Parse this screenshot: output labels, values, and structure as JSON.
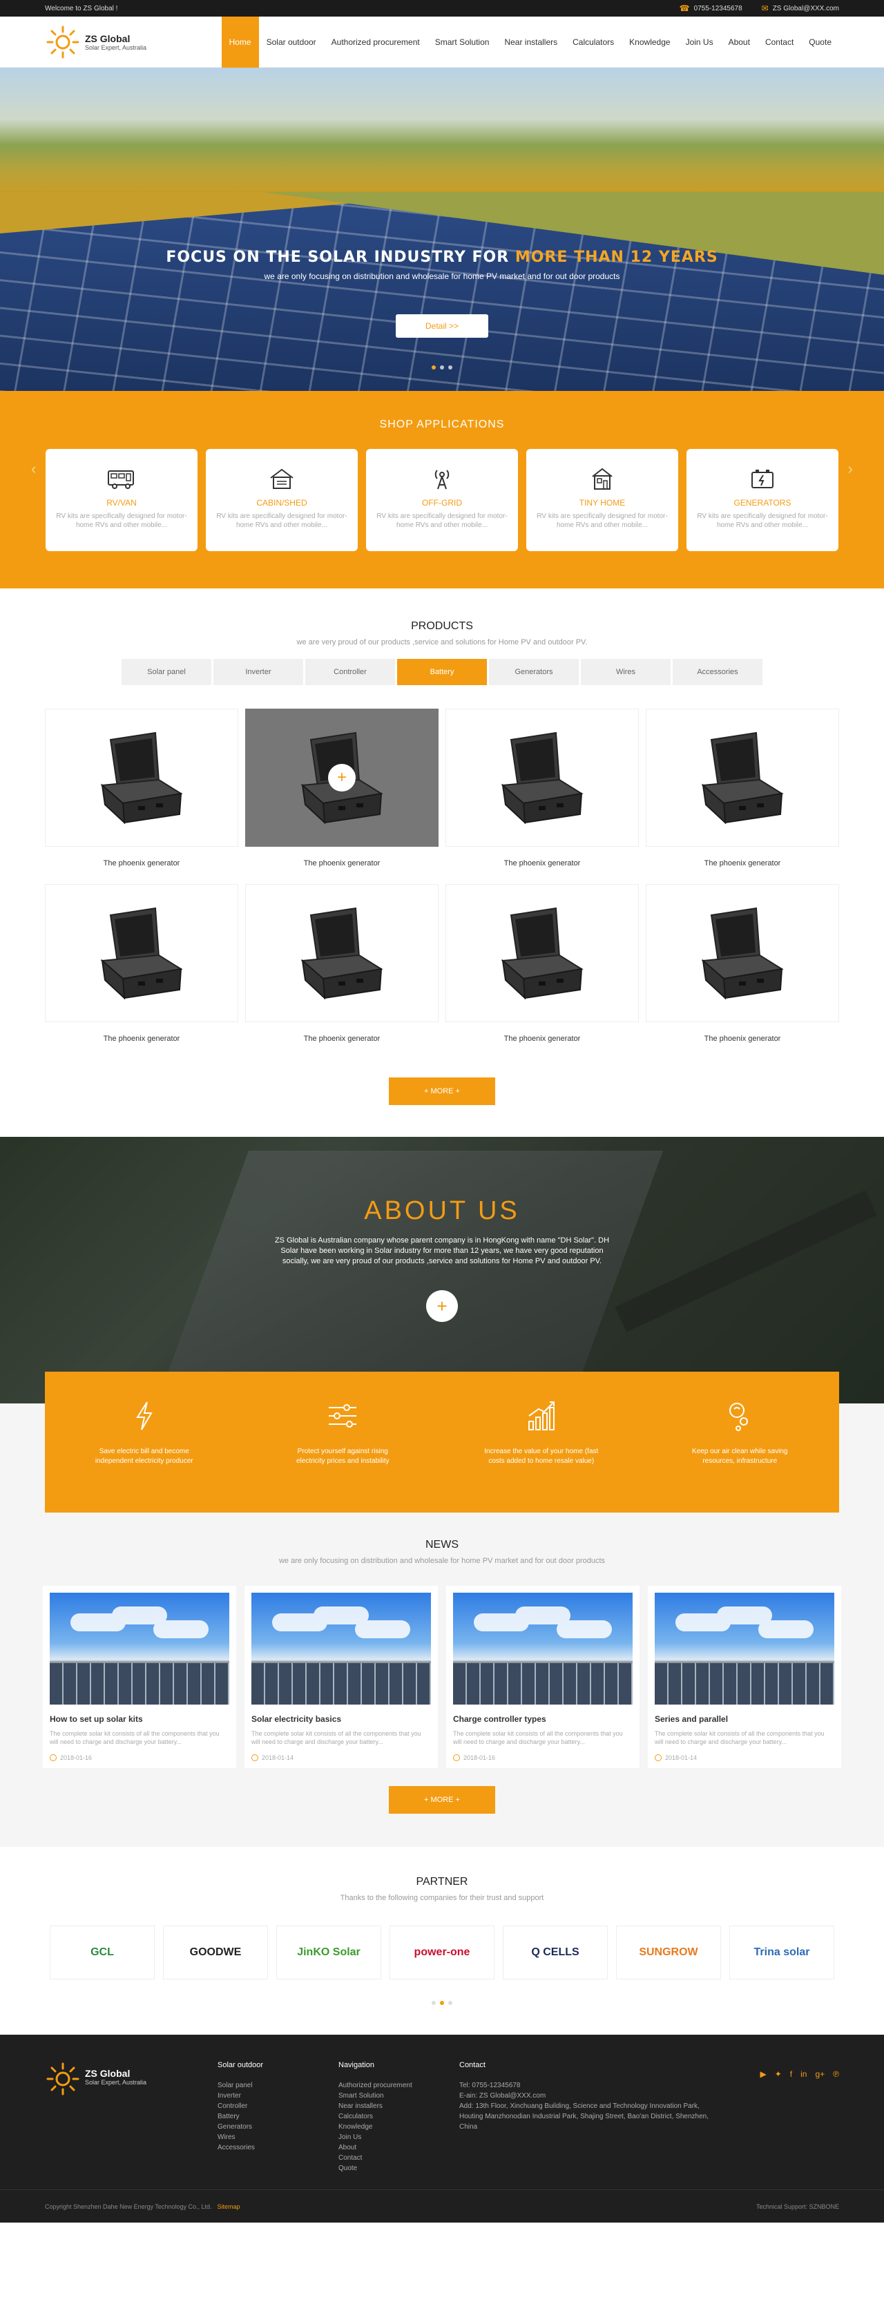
{
  "topbar": {
    "welcome": "Welcome to ZS Global !",
    "phone": "0755-12345678",
    "email": "ZS Global@XXX.com"
  },
  "brand": {
    "name": "ZS Global",
    "tagline": "Solar Expert, Australia",
    "accent": "#f39c12"
  },
  "nav": [
    {
      "label": "Home",
      "active": true
    },
    {
      "label": "Solar outdoor"
    },
    {
      "label": "Authorized procurement"
    },
    {
      "label": "Smart Solution"
    },
    {
      "label": "Near installers"
    },
    {
      "label": "Calculators"
    },
    {
      "label": "Knowledge"
    },
    {
      "label": "Join Us"
    },
    {
      "label": "About"
    },
    {
      "label": "Contact"
    },
    {
      "label": "Quote"
    }
  ],
  "hero": {
    "title_a": "FOCUS ON THE SOLAR INDUSTRY FOR ",
    "title_b": "MORE THAN 12 YEARS",
    "subtitle": "we are only focusing on distribution and wholesale for home PV market and for out door products",
    "button": "Detail >>"
  },
  "shop": {
    "title": "SHOP APPLICATIONS",
    "cards": [
      {
        "name": "RV/VAN",
        "icon": "rv-van-icon",
        "desc": "RV kits are specifically designed for motor-home RVs and other mobile..."
      },
      {
        "name": "CABIN/SHED",
        "icon": "cabin-shed-icon",
        "desc": "RV kits are specifically designed for motor-home RVs and other mobile..."
      },
      {
        "name": "OFF-GRID",
        "icon": "off-grid-tower-icon",
        "desc": "RV kits are specifically designed for motor-home RVs and other mobile..."
      },
      {
        "name": "TINY HOME",
        "icon": "tiny-home-icon",
        "desc": "RV kits are specifically designed for motor-home RVs and other mobile..."
      },
      {
        "name": "GENERATORS",
        "icon": "generator-battery-icon",
        "desc": "RV kits are specifically designed for motor-home RVs and other mobile..."
      }
    ]
  },
  "products": {
    "title": "PRODUCTS",
    "subtitle": "we are very proud of our products ,service and solutions for Home PV and outdoor PV.",
    "tabs": [
      {
        "label": "Solar panel"
      },
      {
        "label": "Inverter"
      },
      {
        "label": "Controller"
      },
      {
        "label": "Battery",
        "active": true
      },
      {
        "label": "Generators"
      },
      {
        "label": "Wires"
      },
      {
        "label": "Accessories"
      }
    ],
    "items": [
      {
        "name": "The phoenix generator"
      },
      {
        "name": "The phoenix generator",
        "hover": true
      },
      {
        "name": "The phoenix generator"
      },
      {
        "name": "The phoenix generator"
      },
      {
        "name": "The phoenix generator"
      },
      {
        "name": "The phoenix generator"
      },
      {
        "name": "The phoenix generator"
      },
      {
        "name": "The phoenix generator"
      }
    ],
    "more": "+ MORE +"
  },
  "about": {
    "title": "ABOUT US",
    "text": "ZS Global is Australian company whose parent company is in HongKong with name \"DH Solar\". DH Solar have been working in Solar industry for more than 12 years, we have very good reputation socially, we are very proud of our products ,service and solutions for Home PV and outdoor PV.",
    "plus": "+"
  },
  "features": [
    {
      "icon": "lightning-icon",
      "text": "Save electric bill and become independent electricity producer"
    },
    {
      "icon": "sliders-icon",
      "text": "Protect yourself against rising electricity prices and instability"
    },
    {
      "icon": "growth-chart-icon",
      "text": "Increase the value of your home (fast costs added to home resale value)"
    },
    {
      "icon": "eco-bulb-icon",
      "text": "Keep our air clean while saving resources, infrastructure"
    }
  ],
  "news": {
    "title": "NEWS",
    "subtitle": "we are only focusing on distribution and wholesale for home PV market and for out door products",
    "items": [
      {
        "title": "How to set up solar kits",
        "desc": "The complete solar kit consists of all the components that you will need to charge and discharge your battery...",
        "date": "2018-01-16"
      },
      {
        "title": "Solar electricity basics",
        "desc": "The complete solar kit consists of all the components that you will need to charge and discharge your battery...",
        "date": "2018-01-14"
      },
      {
        "title": "Charge controller types",
        "desc": "The complete solar kit consists of all the components that you will need to charge and discharge your battery...",
        "date": "2018-01-16"
      },
      {
        "title": "Series and parallel",
        "desc": "The complete solar kit consists of all the components that you will need to charge and discharge your battery...",
        "date": "2018-01-14"
      }
    ],
    "more": "+ MORE +"
  },
  "partner": {
    "title": "PARTNER",
    "subtitle": "Thanks to the following companies for their trust and support",
    "logos": [
      {
        "name": "GCL",
        "color": "#2a8a3c"
      },
      {
        "name": "GOODWE",
        "color": "#222222"
      },
      {
        "name": "JinKO Solar",
        "color": "#3c9a2e"
      },
      {
        "name": "power-one",
        "color": "#c8102e"
      },
      {
        "name": "Q CELLS",
        "color": "#1a2a5a"
      },
      {
        "name": "SUNGROW",
        "color": "#e87a1e"
      },
      {
        "name": "Trina solar",
        "color": "#2d6bb5"
      }
    ]
  },
  "footer": {
    "col1": {
      "title": "Solar outdoor",
      "items": [
        "Solar panel",
        "Inverter",
        "Controller",
        "Battery",
        "Generators",
        "Wires",
        "Accessories"
      ]
    },
    "col2": {
      "title": "Navigation",
      "items": [
        "Authorized procurement",
        "Smart Solution",
        "Near installers",
        "Calculators",
        "Knowledge",
        "Join Us",
        "About",
        "Contact",
        "Quote"
      ]
    },
    "contact": {
      "title": "Contact",
      "tel": "Tel: 0755-12345678",
      "email": "E-ain: ZS Global@XXX.com",
      "addr1": "Add: 13th Floor, Xinchuang Building, Science and Technology Innovation Park,",
      "addr2": "Houting Manzhonodian Industrial Park, Shajing Street, Bao'an District, Shenzhen, China"
    },
    "copyright": "Copyright Shenzhen Dahe New Energy Technology Co., Ltd.",
    "sitemap": "Sitemap",
    "support": "Technical Support: SZNBONE",
    "social": [
      "youtube-icon",
      "twitter-icon",
      "facebook-icon",
      "linkedin-icon",
      "google-plus-icon",
      "pinterest-icon"
    ]
  }
}
